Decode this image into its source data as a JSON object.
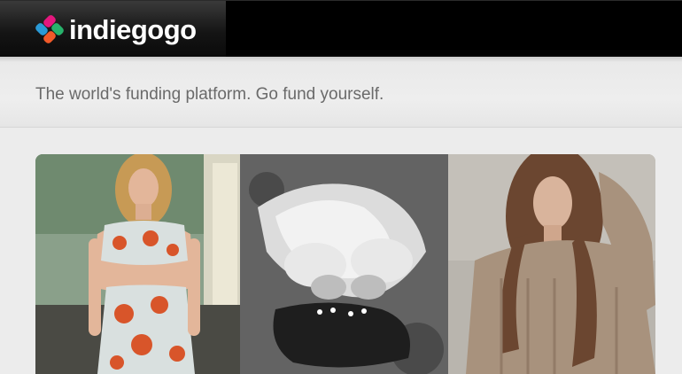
{
  "header": {
    "brand": "indiegogo",
    "logo_icon": "indiegogo-logo-icon",
    "logo_colors": [
      "#e5177e",
      "#27b26b",
      "#2a9ad6",
      "#f15a29"
    ]
  },
  "tagline": "The world's funding platform. Go fund yourself.",
  "gallery": {
    "images": [
      {
        "subject": "model in floral crop top and skirt"
      },
      {
        "subject": "two women in white dresses lying on grass"
      },
      {
        "subject": "woman in knit sweater"
      }
    ]
  }
}
